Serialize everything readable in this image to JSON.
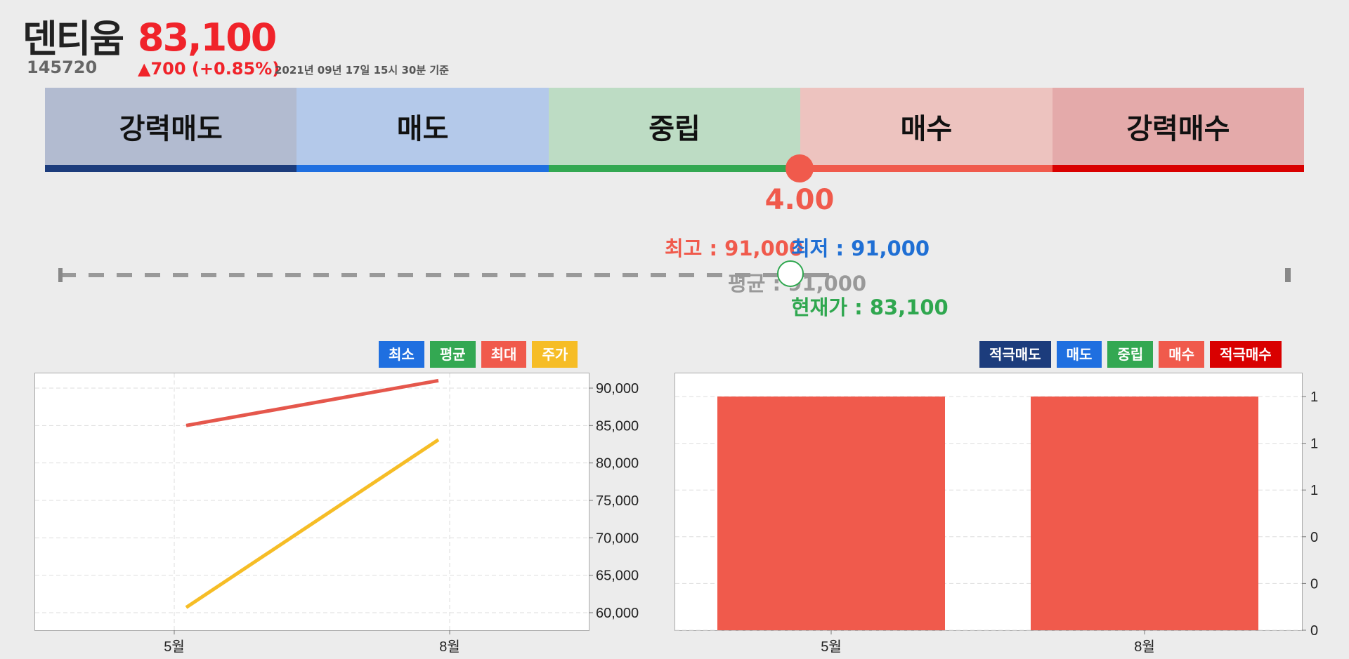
{
  "header": {
    "name": "덴티움",
    "code": "145720",
    "price": "83,100",
    "change": "▲700 (+0.85%)",
    "timestamp": "2021년 09년 17일 15시 30분 기준"
  },
  "signal": {
    "segments": [
      {
        "label": "강력매도",
        "bg": "#b2bbd0",
        "line": "#1c3c7c"
      },
      {
        "label": "매도",
        "bg": "#b4c9ea",
        "line": "#1f6fe0"
      },
      {
        "label": "중립",
        "bg": "#bddcc4",
        "line": "#33a852"
      },
      {
        "label": "매수",
        "bg": "#edc3bf",
        "line": "#f05a4c"
      },
      {
        "label": "강력매수",
        "bg": "#e4aaaa",
        "line": "#d90000"
      }
    ],
    "score": "4.00",
    "marker_color": "#f05a4c"
  },
  "range": {
    "high_label": "최고 : 91,000",
    "low_label": "최저 : 91,000",
    "avg_label": "평균 : 91,000",
    "current_label": "현재가 : 83,100"
  },
  "legend_left": [
    {
      "label": "최소",
      "color": "#1f6fe0"
    },
    {
      "label": "평균",
      "color": "#33a852"
    },
    {
      "label": "최대",
      "color": "#f05a4c"
    },
    {
      "label": "주가",
      "color": "#f6bd26"
    }
  ],
  "legend_right": [
    {
      "label": "적극매도",
      "color": "#1c3c7c"
    },
    {
      "label": "매도",
      "color": "#1f6fe0"
    },
    {
      "label": "중립",
      "color": "#33a852"
    },
    {
      "label": "매수",
      "color": "#f05a4c"
    },
    {
      "label": "적극매수",
      "color": "#d90000"
    }
  ],
  "chart_data": [
    {
      "type": "line",
      "categories": [
        "5월",
        "8월"
      ],
      "series": [
        {
          "name": "최대",
          "color": "#e5574c",
          "values": [
            85000,
            91000
          ]
        },
        {
          "name": "주가",
          "color": "#f6bd26",
          "values": [
            60700,
            83100
          ]
        }
      ],
      "y_ticks": [
        "90,000",
        "85,000",
        "80,000",
        "75,000",
        "70,000",
        "65,000",
        "60,000"
      ],
      "ylim": [
        58000,
        92000
      ],
      "grid": true
    },
    {
      "type": "bar",
      "categories": [
        "5월",
        "8월"
      ],
      "series": [
        {
          "name": "매수",
          "color": "#f05a4c",
          "values": [
            1,
            1
          ]
        }
      ],
      "y_ticks": [
        "1",
        "1",
        "1",
        "0",
        "0",
        "0"
      ],
      "ylim": [
        0,
        1
      ],
      "grid": true
    }
  ]
}
